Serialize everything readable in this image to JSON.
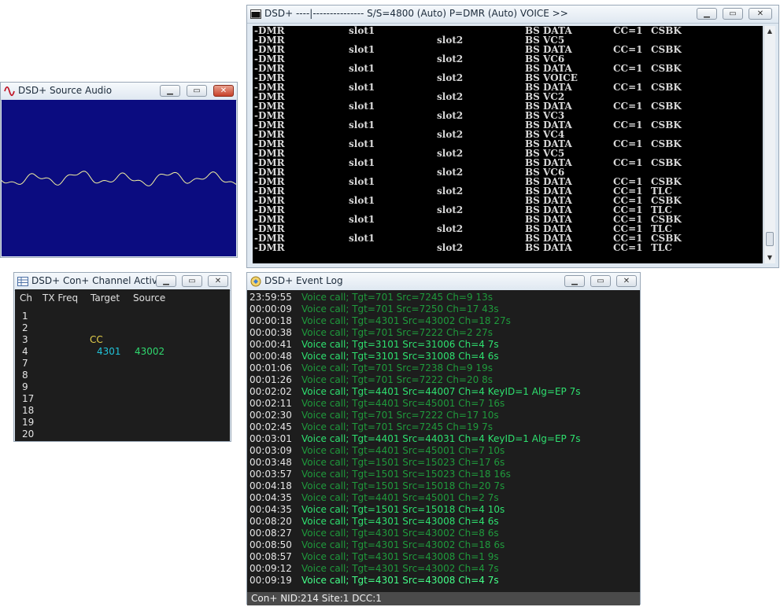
{
  "console": {
    "title": "DSD+    ----|---------------   S/S=4800 (Auto) P=DMR (Auto)        VOICE >>",
    "lines": [
      [
        "-DMR",
        "slot1",
        "",
        "BS DATA",
        "CC=1",
        "CSBK"
      ],
      [
        "-DMR",
        "",
        "slot2",
        "BS VC5",
        "",
        ""
      ],
      [
        "-DMR",
        "slot1",
        "",
        "BS DATA",
        "CC=1",
        "CSBK"
      ],
      [
        "-DMR",
        "",
        "slot2",
        "BS VC6",
        "",
        ""
      ],
      [
        "-DMR",
        "slot1",
        "",
        "BS DATA",
        "CC=1",
        "CSBK"
      ],
      [
        "-DMR",
        "",
        "slot2",
        "BS VOICE",
        "",
        ""
      ],
      [
        "-DMR",
        "slot1",
        "",
        "BS DATA",
        "CC=1",
        "CSBK"
      ],
      [
        "-DMR",
        "",
        "slot2",
        "BS VC2",
        "",
        ""
      ],
      [
        "-DMR",
        "slot1",
        "",
        "BS DATA",
        "CC=1",
        "CSBK"
      ],
      [
        "-DMR",
        "",
        "slot2",
        "BS VC3",
        "",
        ""
      ],
      [
        "-DMR",
        "slot1",
        "",
        "BS DATA",
        "CC=1",
        "CSBK"
      ],
      [
        "-DMR",
        "",
        "slot2",
        "BS VC4",
        "",
        ""
      ],
      [
        "-DMR",
        "slot1",
        "",
        "BS DATA",
        "CC=1",
        "CSBK"
      ],
      [
        "-DMR",
        "",
        "slot2",
        "BS VC5",
        "",
        ""
      ],
      [
        "-DMR",
        "slot1",
        "",
        "BS DATA",
        "CC=1",
        "CSBK"
      ],
      [
        "-DMR",
        "",
        "slot2",
        "BS VC6",
        "",
        ""
      ],
      [
        "-DMR",
        "slot1",
        "",
        "BS DATA",
        "CC=1",
        "CSBK"
      ],
      [
        "-DMR",
        "",
        "slot2",
        "BS DATA",
        "CC=1",
        "TLC"
      ],
      [
        "-DMR",
        "slot1",
        "",
        "BS DATA",
        "CC=1",
        "CSBK"
      ],
      [
        "-DMR",
        "",
        "slot2",
        "BS DATA",
        "CC=1",
        "TLC"
      ],
      [
        "-DMR",
        "slot1",
        "",
        "BS DATA",
        "CC=1",
        "CSBK"
      ],
      [
        "-DMR",
        "",
        "slot2",
        "BS DATA",
        "CC=1",
        "TLC"
      ],
      [
        "-DMR",
        "slot1",
        "",
        "BS DATA",
        "CC=1",
        "CSBK"
      ],
      [
        "-DMR",
        "",
        "slot2",
        "BS DATA",
        "CC=1",
        "TLC"
      ]
    ]
  },
  "audio": {
    "title": "DSD+ Source Audio"
  },
  "channels": {
    "title": "DSD+ Con+ Channel Activ...",
    "headers": {
      "ch": "Ch",
      "txfreq": "TX Freq",
      "target": "Target",
      "source": "Source"
    },
    "rows": [
      {
        "ch": "1",
        "note": "",
        "target": "",
        "source": ""
      },
      {
        "ch": "2",
        "note": "",
        "target": "",
        "source": ""
      },
      {
        "ch": "3",
        "note": "CC",
        "target": "",
        "source": ""
      },
      {
        "ch": "4",
        "note": "",
        "target": "4301",
        "source": "43002"
      },
      {
        "ch": "7",
        "note": "",
        "target": "",
        "source": ""
      },
      {
        "ch": "8",
        "note": "",
        "target": "",
        "source": ""
      },
      {
        "ch": "9",
        "note": "",
        "target": "",
        "source": ""
      },
      {
        "ch": "17",
        "note": "",
        "target": "",
        "source": ""
      },
      {
        "ch": "18",
        "note": "",
        "target": "",
        "source": ""
      },
      {
        "ch": "19",
        "note": "",
        "target": "",
        "source": ""
      },
      {
        "ch": "20",
        "note": "",
        "target": "",
        "source": ""
      }
    ]
  },
  "eventlog": {
    "title": "DSD+ Event Log",
    "status": "Con+  NID:214  Site:1  DCC:1",
    "colors": {
      "dim": "#1f9a3c",
      "bright": "#2ee06f",
      "brightest": "#44ff88"
    },
    "rows": [
      {
        "time": "23:59:55",
        "text": "Voice call; Tgt=701 Src=7245 Ch=9  13s",
        "style": "dim"
      },
      {
        "time": "00:00:09",
        "text": "Voice call; Tgt=701 Src=7250 Ch=17  43s",
        "style": "dim"
      },
      {
        "time": "00:00:18",
        "text": "Voice call; Tgt=4301 Src=43002 Ch=18  27s",
        "style": "dim"
      },
      {
        "time": "00:00:38",
        "text": "Voice call; Tgt=701 Src=7222 Ch=2  27s",
        "style": "dim"
      },
      {
        "time": "00:00:41",
        "text": "Voice call; Tgt=3101 Src=31006 Ch=4  7s",
        "style": "bright"
      },
      {
        "time": "00:00:48",
        "text": "Voice call; Tgt=3101 Src=31008 Ch=4  6s",
        "style": "bright"
      },
      {
        "time": "00:01:06",
        "text": "Voice call; Tgt=701 Src=7238 Ch=9  19s",
        "style": "dim"
      },
      {
        "time": "00:01:26",
        "text": "Voice call; Tgt=701 Src=7222 Ch=20  8s",
        "style": "dim"
      },
      {
        "time": "00:02:02",
        "text": "Voice call; Tgt=4401 Src=44007 Ch=4 KeyID=1  Alg=EP  7s",
        "style": "bright"
      },
      {
        "time": "00:02:11",
        "text": "Voice call; Tgt=4401 Src=45001 Ch=7  16s",
        "style": "dim"
      },
      {
        "time": "00:02:30",
        "text": "Voice call; Tgt=701 Src=7222 Ch=17  10s",
        "style": "dim"
      },
      {
        "time": "00:02:45",
        "text": "Voice call; Tgt=701 Src=7245 Ch=19  7s",
        "style": "dim"
      },
      {
        "time": "00:03:01",
        "text": "Voice call; Tgt=4401 Src=44031 Ch=4 KeyID=1  Alg=EP  7s",
        "style": "bright"
      },
      {
        "time": "00:03:09",
        "text": "Voice call; Tgt=4401 Src=45001 Ch=7  10s",
        "style": "dim"
      },
      {
        "time": "00:03:48",
        "text": "Voice call; Tgt=1501 Src=15023 Ch=17  6s",
        "style": "dim"
      },
      {
        "time": "00:03:57",
        "text": "Voice call; Tgt=1501 Src=15023 Ch=18  16s",
        "style": "dim"
      },
      {
        "time": "00:04:18",
        "text": "Voice call; Tgt=1501 Src=15018 Ch=20  7s",
        "style": "dim"
      },
      {
        "time": "00:04:35",
        "text": "Voice call; Tgt=4401 Src=45001 Ch=2  7s",
        "style": "dim"
      },
      {
        "time": "00:04:35",
        "text": "Voice call; Tgt=1501 Src=15018 Ch=4  10s",
        "style": "bright"
      },
      {
        "time": "00:08:20",
        "text": "Voice call; Tgt=4301 Src=43008 Ch=4  6s",
        "style": "bright"
      },
      {
        "time": "00:08:27",
        "text": "Voice call; Tgt=4301 Src=43002 Ch=8  6s",
        "style": "dim"
      },
      {
        "time": "00:08:50",
        "text": "Voice call; Tgt=4301 Src=43002 Ch=18  6s",
        "style": "dim"
      },
      {
        "time": "00:08:57",
        "text": "Voice call; Tgt=4301 Src=43008 Ch=1  9s",
        "style": "dim"
      },
      {
        "time": "00:09:12",
        "text": "Voice call; Tgt=4301 Src=43002 Ch=4  7s",
        "style": "dim"
      },
      {
        "time": "00:09:19",
        "text": "Voice call; Tgt=4301 Src=43008 Ch=4  7s",
        "style": "brightest"
      }
    ]
  },
  "window_buttons": {
    "minimize": "▁",
    "maximize": "▭",
    "close": "✕"
  }
}
